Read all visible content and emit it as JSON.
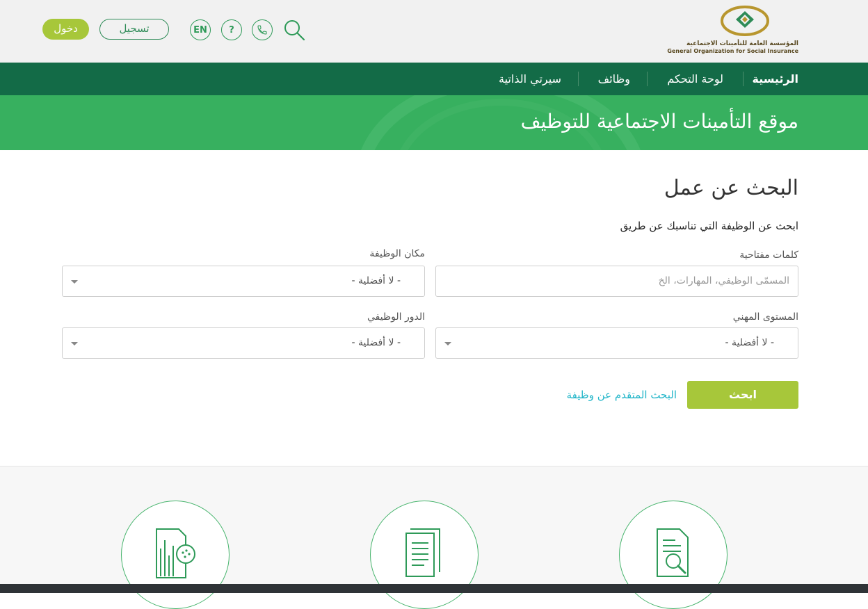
{
  "header": {
    "logo_ar": "المؤسسة العامة للتأمينات الاجتماعية",
    "logo_en": "General Organization for Social Insurance",
    "login_label": "دخول",
    "register_label": "تسجيل",
    "lang_label": "EN",
    "help_label": "?",
    "icons": [
      "phone-icon",
      "search-icon",
      "help-icon",
      "language-icon"
    ]
  },
  "nav": {
    "items": [
      "الرئيسية",
      "لوحة التحكم",
      "وظائف",
      "سيرتي الذاتية"
    ]
  },
  "banner": {
    "title": "موقع التأمينات الاجتماعية للتوظيف"
  },
  "search_form": {
    "title": "البحث عن عمل",
    "subtitle": "ابحث عن الوظيفة التي تناسبك عن طريق",
    "keywords_label": "كلمات مفتاحية",
    "keywords_placeholder": "المسمّى الوظيفي، المهارات، الخ",
    "location_label": "مكان الوظيفة",
    "location_value": "- لا أفضلية -",
    "level_label": "المستوى المهني",
    "level_value": "- لا أفضلية -",
    "role_label": "الدور الوظيفي",
    "role_value": "- لا أفضلية -",
    "search_button": "ابحث",
    "advanced_link": "البحث المتقدم عن وظيفة"
  },
  "colors": {
    "nav_bg": "#136b47",
    "banner_bg": "#37b05f",
    "accent": "#a7c73a",
    "link": "#23b6c9"
  }
}
